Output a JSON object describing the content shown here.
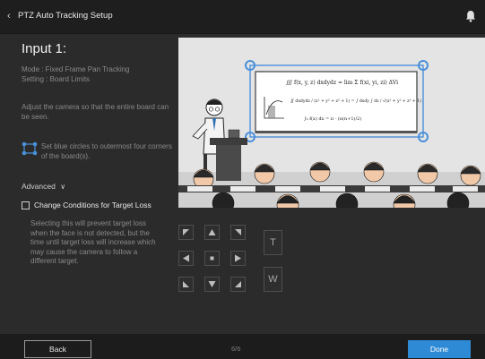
{
  "header": {
    "title": "PTZ Auto Tracking Setup",
    "back_icon": "chevron-left-icon",
    "notification_icon": "bell-icon"
  },
  "left_panel": {
    "heading": "Input 1:",
    "mode_line": "Mode : Fixed Frame Pan Tracking",
    "setting_line": "Setting : Board Limits",
    "adjust_text": "Adjust the camera so that the entire board can be seen.",
    "hint_text": "Set blue circles to outermost four corners of the board(s).",
    "advanced_label": "Advanced",
    "checkbox_label": "Change Conditions for Target Loss",
    "checkbox_checked": false,
    "description": "Selecting this will prevent target loss when the face is not detected, but the time until target loss will increase which may cause the camera to follow a different target."
  },
  "camera_view": {
    "corner_handle_color": "#4a90d9",
    "board_formulas": [
      "∭ f(x, y, z) dxdydz = lim Σ f(xi, yi, zi) ΔVi",
      "∬ dxdydz / (x² + y² + z² + 1) = ∫ dxdy ∫ dz / √(x² + y² + z² + 1)",
      "∫₀ f(x) dx = π · (n(n+1)/2)"
    ]
  },
  "ptz_controls": {
    "pan_tilt_icons": [
      "arrow-up-left-icon",
      "arrow-up-icon",
      "arrow-up-right-icon",
      "arrow-left-icon",
      "stop-icon",
      "arrow-right-icon",
      "arrow-down-left-icon",
      "arrow-down-icon",
      "arrow-down-right-icon"
    ],
    "zoom_tele_label": "T",
    "zoom_wide_label": "W"
  },
  "footer": {
    "back_label": "Back",
    "page_indicator": "6/6",
    "done_label": "Done",
    "done_color": "#2f8ad6"
  }
}
